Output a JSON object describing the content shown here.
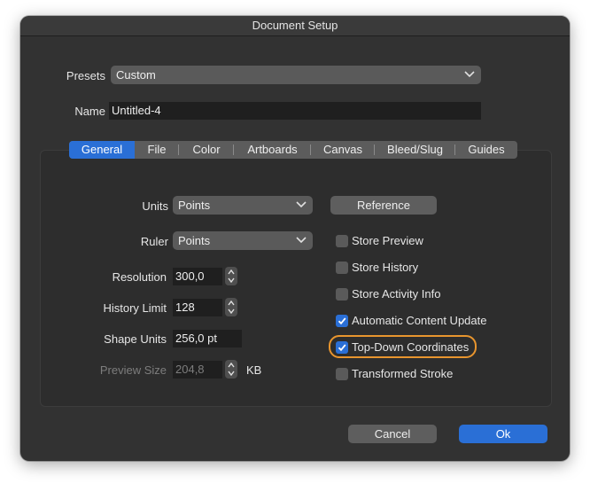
{
  "window": {
    "title": "Document Setup"
  },
  "presets": {
    "label": "Presets",
    "value": "Custom"
  },
  "name": {
    "label": "Name",
    "value": "Untitled-4"
  },
  "tabs": [
    {
      "label": "General",
      "selected": true
    },
    {
      "label": "File",
      "selected": false
    },
    {
      "label": "Color",
      "selected": false
    },
    {
      "label": "Artboards",
      "selected": false
    },
    {
      "label": "Canvas",
      "selected": false
    },
    {
      "label": "Bleed/Slug",
      "selected": false
    },
    {
      "label": "Guides",
      "selected": false
    }
  ],
  "general": {
    "units": {
      "label": "Units",
      "value": "Points"
    },
    "ruler": {
      "label": "Ruler",
      "value": "Points"
    },
    "resolution": {
      "label": "Resolution",
      "value": "300,0"
    },
    "history_limit": {
      "label": "History Limit",
      "value": "128"
    },
    "shape_units": {
      "label": "Shape Units",
      "value": "256,0 pt"
    },
    "preview_size": {
      "label": "Preview Size",
      "value": "204,8",
      "unit": "KB"
    },
    "reference_button": "Reference",
    "checkboxes": [
      {
        "label": "Store Preview",
        "checked": false
      },
      {
        "label": "Store History",
        "checked": false
      },
      {
        "label": "Store Activity Info",
        "checked": false
      },
      {
        "label": "Automatic Content Update",
        "checked": true
      },
      {
        "label": "Top-Down Coordinates",
        "checked": true,
        "highlighted": true
      },
      {
        "label": "Transformed Stroke",
        "checked": false
      }
    ]
  },
  "footer": {
    "cancel_label": "Cancel",
    "ok_label": "Ok"
  },
  "colors": {
    "accent": "#2a6fd6",
    "highlight": "#e8952e"
  }
}
